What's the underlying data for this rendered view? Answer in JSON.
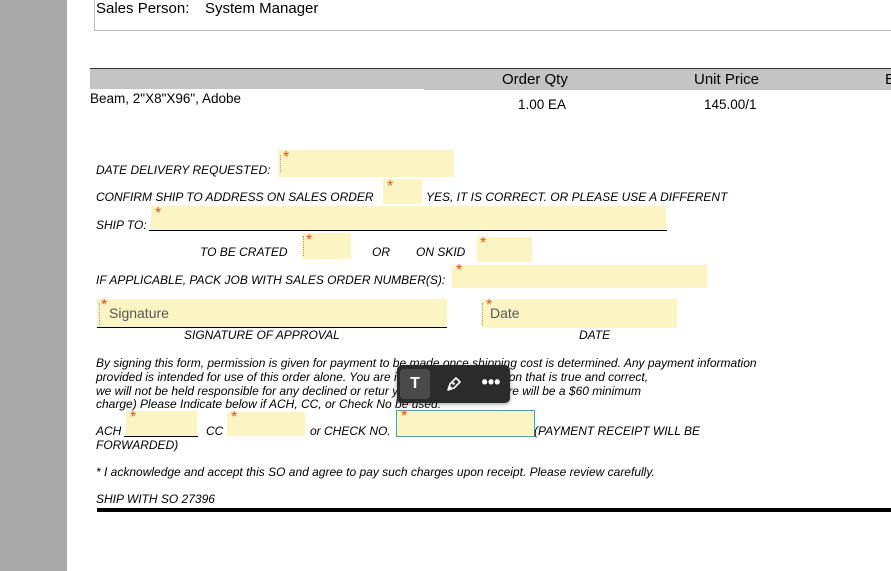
{
  "header": {
    "sales_person_label": "Sales Person:",
    "sales_person_value": "System Manager"
  },
  "table": {
    "headers": [
      "Order Qty",
      "Unit Price",
      "E"
    ],
    "row": {
      "description": "Beam, 2\"X8\"X96\", Adobe",
      "qty": "1.00 EA",
      "price": "145.00/1"
    }
  },
  "form": {
    "date_delivery_label": "DATE DELIVERY REQUESTED:",
    "confirm_ship_label": "CONFIRM SHIP TO ADDRESS ON SALES ORDER",
    "yes_correct_label": "YES, IT IS CORRECT.   OR PLEASE USE A DIFFERENT",
    "ship_to_label": "SHIP TO:",
    "to_be_crated_label": "TO BE CRATED",
    "or_label": "OR",
    "on_skid_label": "ON SKID",
    "pack_job_label": "IF APPLICABLE, PACK JOB WITH SALES ORDER NUMBER(S):",
    "signature_placeholder": "Signature",
    "date_placeholder": "Date",
    "signature_caption": "SIGNATURE OF APPROVAL",
    "date_caption": "DATE",
    "paragraph_lines": [
      "By signing this form, permission is given for payment to be made once shipping cost is determined. Any payment information",
      "provided is intended for use of this order alone. You are                                          ing payment information that is true and correct,",
      "we will not be held responsible for any declined or retur                                          yment is returned, there will be a $60 minimum",
      "charge)  Please Indicate below if ACH, CC, or Check No               be used."
    ],
    "ach_label": "ACH",
    "cc_label": "CC",
    "or_check_label": "or  CHECK NO.",
    "payment_receipt_label": "(PAYMENT RECEIPT WILL BE",
    "forwarded_label": "FORWARDED)",
    "acknowledge": "* I acknowledge and accept this SO and agree to pay such charges upon receipt. Please review carefully.",
    "ship_with": "SHIP WITH SO 27396",
    "required_mark": "*"
  },
  "toolbar": {
    "text_tool_label": "T",
    "more_label": "•••",
    "icons": [
      "text-tool-icon",
      "pen-icon",
      "more-icon"
    ]
  },
  "colors": {
    "field_fill": "#fdf4c4",
    "required_mark": "#e2521a",
    "toolbar_bg": "#2b2b2b"
  }
}
